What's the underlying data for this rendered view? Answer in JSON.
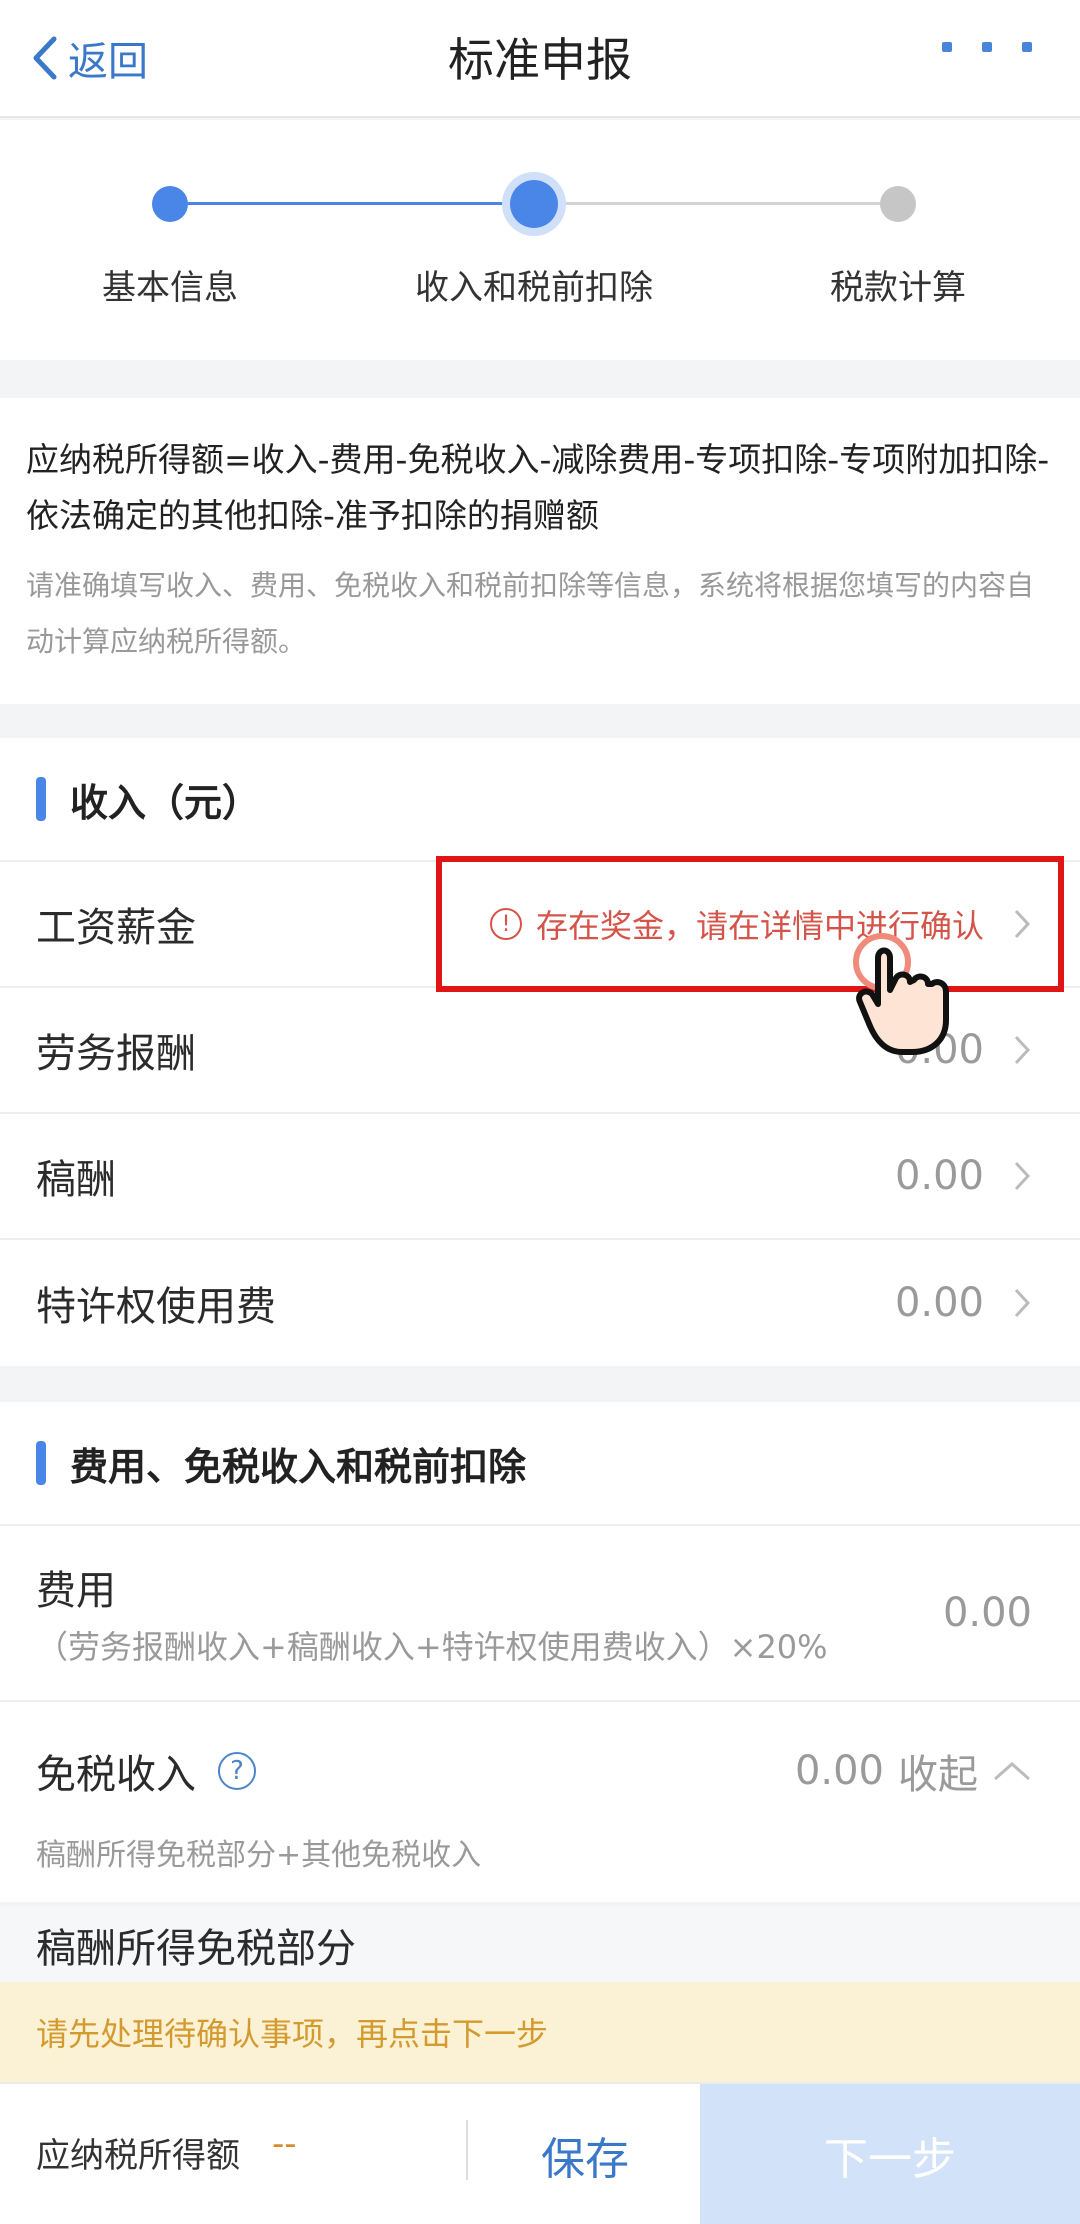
{
  "nav": {
    "back_label": "返回",
    "title": "标准申报"
  },
  "steps": [
    {
      "label": "基本信息",
      "state": "done"
    },
    {
      "label": "收入和税前扣除",
      "state": "current"
    },
    {
      "label": "税款计算",
      "state": "pending"
    }
  ],
  "formula": {
    "text": "应纳税所得额=收入-费用-免税收入-减除费用-专项扣除-专项附加扣除-依法确定的其他扣除-准予扣除的捐赠额",
    "note": "请准确填写收入、费用、免税收入和税前扣除等信息，系统将根据您填写的内容自动计算应纳税所得额。"
  },
  "income": {
    "title": "收入（元）",
    "rows": [
      {
        "label": "工资薪金",
        "warning": "存在奖金，请在详情中进行确认"
      },
      {
        "label": "劳务报酬",
        "value": "0.00"
      },
      {
        "label": "稿酬",
        "value": "0.00"
      },
      {
        "label": "特许权使用费",
        "value": "0.00"
      }
    ]
  },
  "deduction": {
    "title": "费用、免税收入和税前扣除",
    "fee": {
      "label": "费用",
      "formula": "（劳务报酬收入+稿酬收入+特许权使用费收入）×20%",
      "value": "0.00"
    },
    "exempt": {
      "label": "免税收入",
      "help": "?",
      "value": "0.00",
      "toggle": "收起",
      "sub": "稿酬所得免税部分+其他免税收入"
    },
    "royalty_exempt": {
      "label": "稿酬所得免税部分"
    }
  },
  "banner": {
    "text": "请先处理待确认事项，再点击下一步"
  },
  "bottom": {
    "tax_label": "应纳税所得额",
    "tax_value": "--",
    "save_label": "保存",
    "next_label": "下一步"
  },
  "colors": {
    "accent": "#4a86e8",
    "warning": "#d4544a",
    "highlight": "#e01616",
    "banner_bg": "#fbf1d4",
    "next_disabled": "#d2e3f9"
  }
}
